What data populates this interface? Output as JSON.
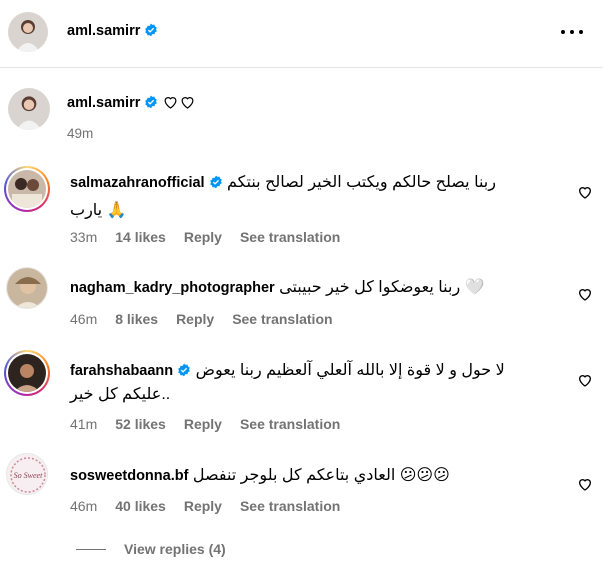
{
  "post": {
    "username": "aml.samirr",
    "caption_time": "49m"
  },
  "colors": {
    "verified": "#0095f6",
    "meta": "#737373",
    "divider": "#e6e6e6"
  },
  "comments": [
    {
      "username": "salmazahranofficial",
      "verified": true,
      "text_line1": "ربنا يصلح حالكم ويكتب الخير لصالح بنتكم",
      "text_line2": "يارب 🙏",
      "time": "33m",
      "likes": "14 likes",
      "reply": "Reply",
      "see_translation": "See translation"
    },
    {
      "username": "nagham_kadry_photographer",
      "verified": false,
      "text_line1": "ربنا يعوضكوا كل خير حبيبتى 🤍",
      "time": "46m",
      "likes": "8 likes",
      "reply": "Reply",
      "see_translation": "See translation"
    },
    {
      "username": "farahshabaann",
      "verified": true,
      "text_line1": "لا حول و لا قوة إلا بالله آلعلي آلعظيم ربنا يعوض",
      "text_line2": "عليكم كل خير..",
      "time": "41m",
      "likes": "52 likes",
      "reply": "Reply",
      "see_translation": "See translation"
    },
    {
      "username": "sosweetdonna.bf",
      "verified": false,
      "text_line1": "العادي بتاعكم كل بلوجر تنفصل 😕😕😕",
      "avatar_text": "So Sweet",
      "time": "46m",
      "likes": "40 likes",
      "reply": "Reply",
      "see_translation": "See translation"
    }
  ],
  "view_replies": "View replies (4)",
  "icons": {
    "more": "more-horizontal-icon",
    "verified": "verified-badge-icon",
    "heart": "heart-outline-icon"
  }
}
